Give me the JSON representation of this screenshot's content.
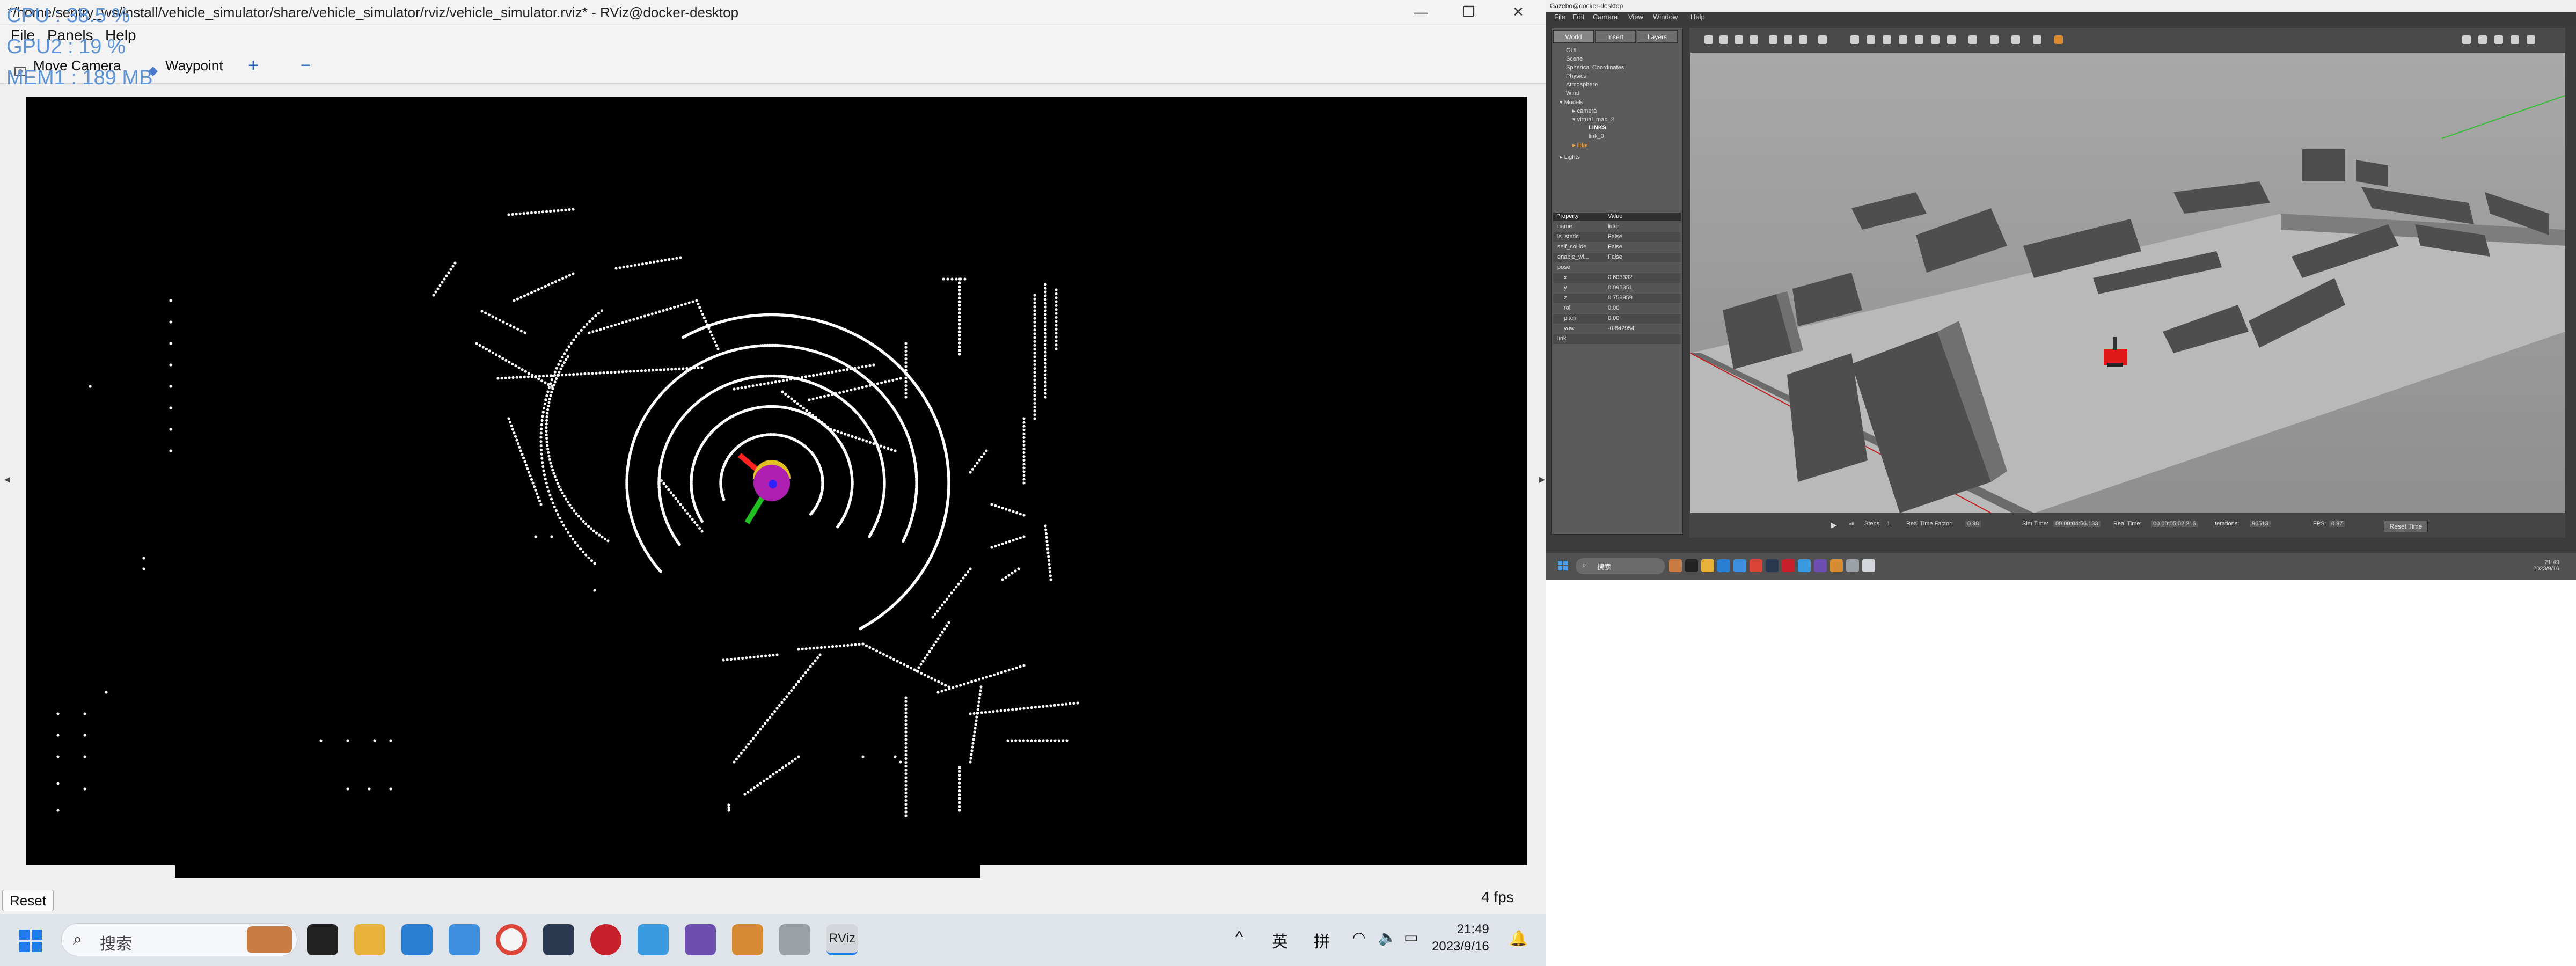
{
  "rviz": {
    "window_title": "*/home/sentry_ws/install/vehicle_simulator/share/vehicle_simulator/rviz/vehicle_simulator.rviz* - RViz@docker-desktop",
    "overlay_stats": [
      "CPU : 38.5 %",
      "GPU2 : 19 %",
      "MEM1 : 189 MB"
    ],
    "menu": [
      "File",
      "Panels",
      "Help"
    ],
    "toolbar": {
      "move_camera": "Move Camera",
      "waypoint": "Waypoint",
      "plus": "+",
      "minus": "−"
    },
    "reset_label": "Reset",
    "fps": "4 fps",
    "pointcloud_color": "#ffffff",
    "robot_color": "#b020b0",
    "axis_colors": {
      "x": "#ff2020",
      "y": "#20c020"
    }
  },
  "taskbar": {
    "search_placeholder": "搜索",
    "tray": {
      "chevron": "^",
      "ime_lang": "英",
      "ime_mode": "拼"
    },
    "time": "21:49",
    "date": "2023/9/16",
    "active_label": "RViz"
  },
  "gazebo": {
    "window_title": "Gazebo@docker-desktop",
    "menu": [
      "File",
      "Edit",
      "Camera",
      "View",
      "Window",
      "Help"
    ],
    "tabs": [
      "World",
      "Insert",
      "Layers"
    ],
    "tree": [
      "GUI",
      "Scene",
      "Spherical Coordinates",
      "Physics",
      "Atmosphere",
      "Wind",
      "Models",
      "camera",
      "virtual_map_2",
      "LINKS",
      "link_0",
      "lidar",
      "Lights"
    ],
    "props_header": [
      "Property",
      "Value"
    ],
    "props": [
      [
        "name",
        "lidar"
      ],
      [
        "is_static",
        "False"
      ],
      [
        "self_collide",
        "False"
      ],
      [
        "enable_wi...",
        "False"
      ],
      [
        "pose",
        ""
      ],
      [
        "x",
        "0.603332"
      ],
      [
        "y",
        "0.095351"
      ],
      [
        "z",
        "0.758959"
      ],
      [
        "roll",
        "0.00"
      ],
      [
        "pitch",
        "0.00"
      ],
      [
        "yaw",
        "-0.842954"
      ],
      [
        "link",
        ""
      ]
    ],
    "status": {
      "steps_label": "Steps:",
      "steps_value": "1",
      "rtf_label": "Real Time Factor:",
      "rtf_value": "0.98",
      "sim_time_label": "Sim Time:",
      "sim_time_value": "00 00:04:56.133",
      "real_time_label": "Real Time:",
      "real_time_value": "00 00:05:02.216",
      "iterations_label": "Iterations:",
      "iterations_value": "96513",
      "fps_label": "FPS:",
      "fps_value": "0.97",
      "reset_time": "Reset Time"
    },
    "taskbar": {
      "search": "搜索",
      "time": "21:49",
      "date": "2023/9/16"
    }
  }
}
